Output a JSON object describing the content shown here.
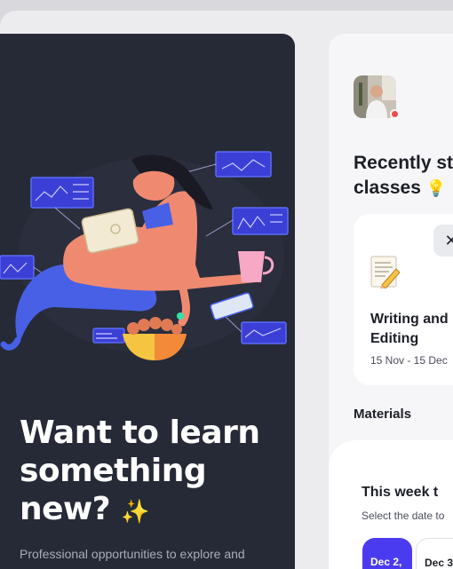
{
  "promo": {
    "title": "Want to learn something new?",
    "sparkle": "✨",
    "subtitle": "Professional opportunities to explore and learn new skills"
  },
  "panel": {
    "avatar_status": "online",
    "recent_title": "Recently st",
    "recent_title_line2": "classes",
    "bulb": "💡",
    "class_card": {
      "nav_arrow": "✕",
      "name": "Writing and Editing",
      "dates": "15 Nov - 15 Dec"
    },
    "materials_label": "Materials",
    "week": {
      "title": "This week t",
      "subtitle": "Select the date to",
      "dates": [
        "Dec 2,",
        "Dec 3"
      ]
    }
  },
  "colors": {
    "promo_bg": "#262a36",
    "accent": "#4b3bf0",
    "status": "#ef4b4b"
  }
}
